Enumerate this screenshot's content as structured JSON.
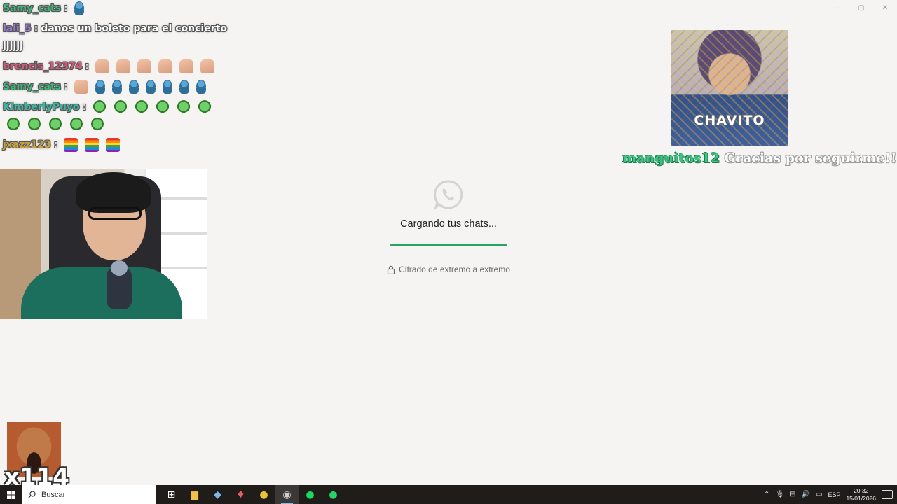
{
  "window": {
    "controls": {
      "minimize": "—",
      "maximize": "▢",
      "close": "✕"
    }
  },
  "chat": [
    {
      "user": "Samy_cats",
      "color": "#3fb57a",
      "text": "",
      "emotes": [
        "blue"
      ]
    },
    {
      "user": "lali_5",
      "color": "#9b7ad3",
      "text": "danos un boleto para el concierto jjjjjj",
      "emotes": []
    },
    {
      "user": "brencis_12374",
      "color": "#d15a7a",
      "text": "",
      "emotes": [
        "hand",
        "hand",
        "hand",
        "hand",
        "hand",
        "hand"
      ]
    },
    {
      "user": "Samy_cats",
      "color": "#3fb57a",
      "text": "",
      "emotes": [
        "hand",
        "blue",
        "blue",
        "blue",
        "blue",
        "blue",
        "blue",
        "blue"
      ]
    },
    {
      "user": "KimberlyPuyo",
      "color": "#3fb5a0",
      "text": "",
      "emotes": [
        "shrek",
        "shrek",
        "shrek",
        "shrek",
        "shrek",
        "shrek",
        "shrek",
        "shrek",
        "shrek",
        "shrek",
        "shrek"
      ]
    },
    {
      "user": "jxazz123",
      "color": "#c9a23a",
      "text": "",
      "emotes": [
        "pride",
        "pride",
        "pride"
      ]
    }
  ],
  "alert": {
    "image_label": "CHAVITO",
    "username": "manguitos12",
    "message": "Gracias por seguirme!!"
  },
  "whatsapp": {
    "loading_text": "Cargando tus chats...",
    "progress": 1.0,
    "encryption_text": "Cifrado de extremo a extremo",
    "accent": "#25a464"
  },
  "combo": {
    "count": "x114"
  },
  "taskbar": {
    "search_placeholder": "Buscar",
    "apps": [
      {
        "name": "task-view-icon",
        "glyph": "⊞",
        "active": false
      },
      {
        "name": "file-explorer-icon",
        "glyph": "▆",
        "active": false
      },
      {
        "name": "notes-app-icon",
        "glyph": "◆",
        "active": false
      },
      {
        "name": "media-app-icon",
        "glyph": "♦",
        "active": false
      },
      {
        "name": "chrome-icon",
        "glyph": "●",
        "active": false
      },
      {
        "name": "obs-icon",
        "glyph": "◉",
        "active": true
      },
      {
        "name": "spotify-icon",
        "glyph": "●",
        "active": false
      },
      {
        "name": "whatsapp-icon",
        "glyph": "●",
        "active": false
      }
    ],
    "tray": {
      "language": "ESP",
      "time": "20:32",
      "date": "15/01/2026"
    }
  }
}
